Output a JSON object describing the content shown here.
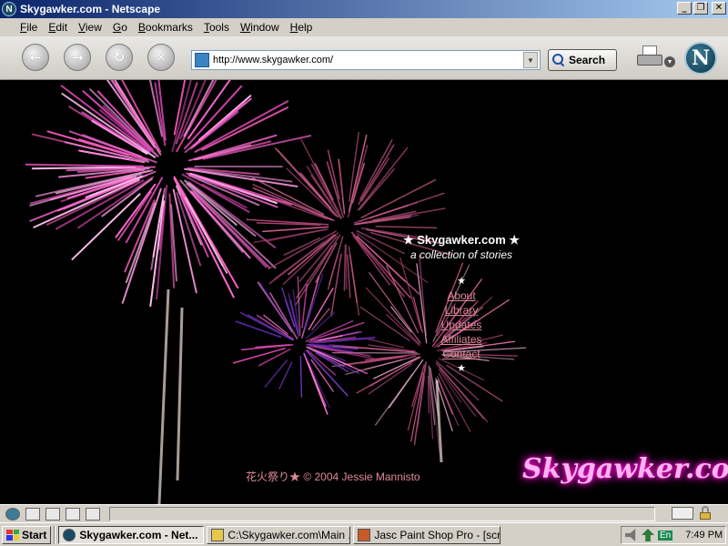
{
  "window": {
    "title": "Skygawker.com - Netscape",
    "app_icon_letter": "N",
    "controls": [
      "_",
      "❐",
      "✕"
    ]
  },
  "menu": [
    "File",
    "Edit",
    "View",
    "Go",
    "Bookmarks",
    "Tools",
    "Window",
    "Help"
  ],
  "toolbar": {
    "back_icon": "back-arrow",
    "forward_icon": "forward-arrow",
    "reload_icon": "reload-arrow",
    "stop_icon": "stop-x",
    "url": "http://www.skygawker.com/",
    "search_label": "Search",
    "logo_letter": "N"
  },
  "page": {
    "site_title": "★ Skygawker.com ★",
    "tagline": "a collection of stories",
    "star": "★",
    "links": [
      "About",
      "Library",
      "Updates",
      "Affiliates",
      "Contact"
    ],
    "footer": "花火祭り★ © 2004 Jessie Mannisto",
    "logo": "Skygawker.com",
    "colors": {
      "link": "#e08a9a",
      "background": "#000000",
      "logo_glow": "#ff00d4"
    }
  },
  "taskbar": {
    "start_label": "Start",
    "tasks": [
      {
        "label": "Skygawker.com - Net...",
        "active": true
      },
      {
        "label": "C:\\Skygawker.com\\Main ...",
        "active": false
      },
      {
        "label": "Jasc Paint Shop Pro - [scr...",
        "active": false
      }
    ],
    "language": "En",
    "clock": "7:49 PM"
  }
}
